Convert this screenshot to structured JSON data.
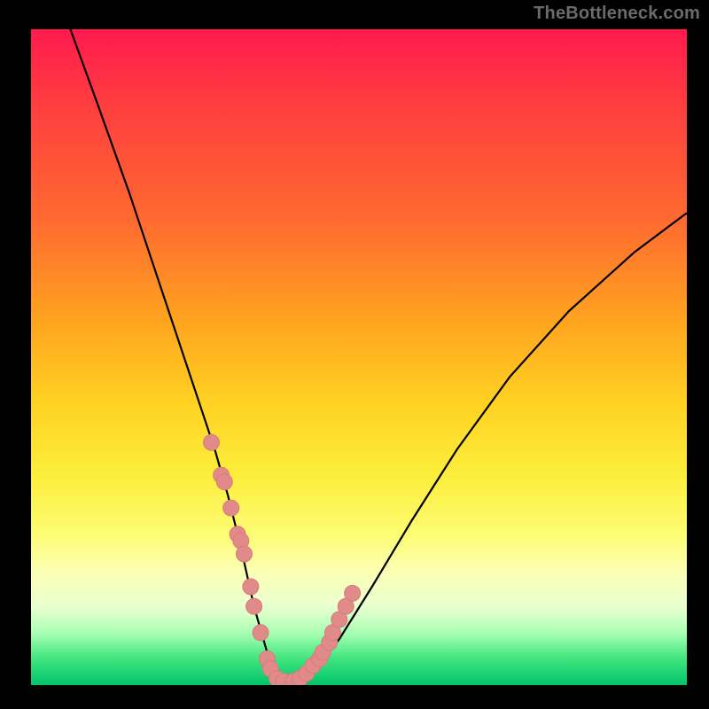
{
  "watermark": "TheBottleneck.com",
  "colors": {
    "curve": "#000000",
    "marker_fill": "#e08a8a",
    "marker_stroke": "#d87b7b",
    "background_frame": "#000000"
  },
  "chart_data": {
    "type": "line",
    "title": "",
    "xlabel": "",
    "ylabel": "",
    "xlim": [
      0,
      100
    ],
    "ylim": [
      0,
      100
    ],
    "grid": false,
    "legend_position": "none",
    "series": [
      {
        "name": "bottleneck-curve",
        "x": [
          6,
          10,
          15,
          20,
          23,
          26,
          28,
          30,
          32,
          34,
          36,
          37,
          38,
          40,
          43,
          47,
          52,
          58,
          65,
          73,
          82,
          92,
          100
        ],
        "values": [
          100,
          89,
          75,
          60,
          51,
          42,
          36,
          29,
          21,
          12,
          5,
          2,
          0.5,
          0.5,
          2,
          7,
          15,
          25,
          36,
          47,
          57,
          66,
          72
        ]
      }
    ],
    "markers": {
      "name": "highlighted-points",
      "x": [
        27.5,
        29.0,
        29.5,
        30.5,
        31.5,
        32.0,
        32.5,
        33.5,
        34.0,
        35.0,
        36.0,
        36.5,
        37.5,
        38.5,
        40.0,
        41.0,
        42.0,
        43.0,
        44.0,
        44.5,
        45.5,
        46.0,
        47.0,
        48.0,
        49.0
      ],
      "values": [
        37.0,
        32.0,
        31.0,
        27.0,
        23.0,
        22.0,
        20.0,
        15.0,
        12.0,
        8.0,
        4.0,
        2.5,
        1.0,
        0.6,
        0.6,
        1.0,
        1.8,
        3.0,
        4.0,
        5.0,
        6.5,
        8.0,
        10.0,
        12.0,
        14.0
      ]
    }
  }
}
